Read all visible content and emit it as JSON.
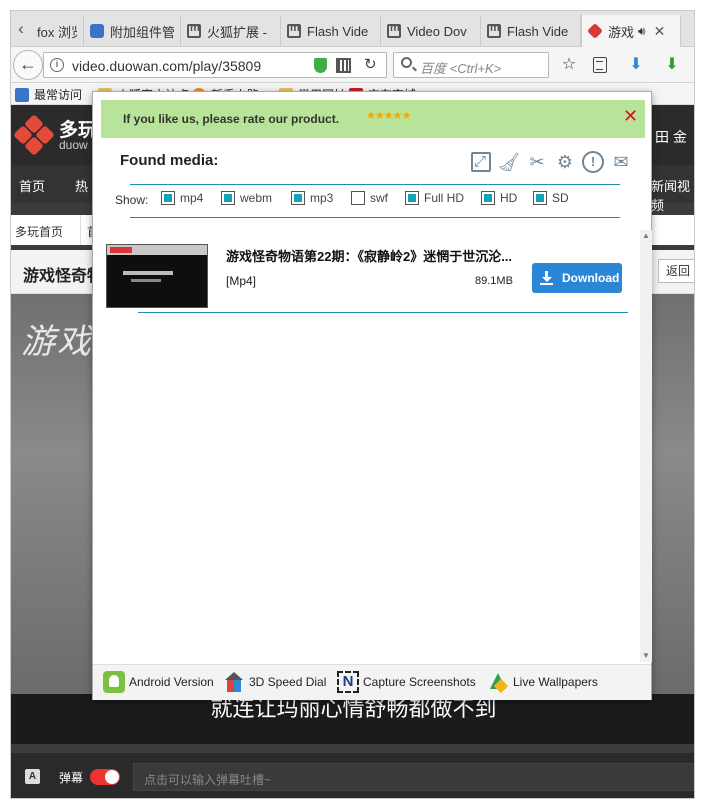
{
  "browser": {
    "tabs": [
      {
        "title": "fox 浏览",
        "icon": "none"
      },
      {
        "title": "附加组件管",
        "icon": "puzzle-icon"
      },
      {
        "title": "火狐扩展 -",
        "icon": "m-icon"
      },
      {
        "title": "Flash Vide",
        "icon": "m-icon"
      },
      {
        "title": "Video Dov",
        "icon": "m-icon"
      },
      {
        "title": "Flash Vide",
        "icon": "m-icon"
      },
      {
        "title": "游戏",
        "icon": "duowan-icon",
        "active": true
      }
    ],
    "url": "video.duowan.com/play/35809",
    "search_placeholder": "百度 <Ctrl+K>",
    "bookmarks": [
      {
        "label": "最常访问"
      },
      {
        "label": "火狐官方站点"
      },
      {
        "label": "新手上路"
      },
      {
        "label": "常用网址"
      },
      {
        "label": "京东商城"
      }
    ]
  },
  "site": {
    "logo_text": "多玩",
    "logo_sub": "duow",
    "header_right": "田 金",
    "nav": [
      "首页",
      "热"
    ],
    "nav_right": "新闻视频",
    "breadcrumb_home": "多玩首页",
    "breadcrumb_next": "首",
    "page_title": "游戏怪奇物",
    "return_label": "返回",
    "video_overlay_text": "游戏",
    "subtitle": "就连让玛丽心情舒畅都做不到",
    "danmaku_label": "弹幕",
    "danmaku_placeholder": "点击可以输入弹幕吐槽~"
  },
  "popup": {
    "rate_text": "If you like us, please rate our product.",
    "rate_stars": "★★★★★",
    "close_glyph": "✕",
    "found_title": "Found media:",
    "show_label": "Show:",
    "filters": [
      {
        "label": "mp4",
        "checked": true
      },
      {
        "label": "webm",
        "checked": true
      },
      {
        "label": "mp3",
        "checked": true
      },
      {
        "label": "swf",
        "checked": false
      },
      {
        "label": "Full HD",
        "checked": true
      },
      {
        "label": "HD",
        "checked": true
      },
      {
        "label": "SD",
        "checked": true
      }
    ],
    "media": [
      {
        "title": "游戏怪奇物语第22期：《寂静岭2》迷惘于世沉沦...",
        "format": "[Mp4]",
        "size": "89.1MB",
        "download_label": "Download"
      }
    ],
    "footer_links": [
      {
        "label": "Android Version",
        "icon": "android-icon"
      },
      {
        "label": "3D Speed Dial",
        "icon": "speed-dial-icon"
      },
      {
        "label": "Capture Screenshots",
        "icon": "capture-icon"
      },
      {
        "label": "Live Wallpapers",
        "icon": "wallpaper-icon"
      }
    ]
  },
  "colors": {
    "rate_bar": "#b8e49a",
    "accent": "#1d8eb0",
    "checkbox_fill": "#11a4b9",
    "download_btn": "#2b86d6",
    "close_red": "#c41c1c"
  }
}
